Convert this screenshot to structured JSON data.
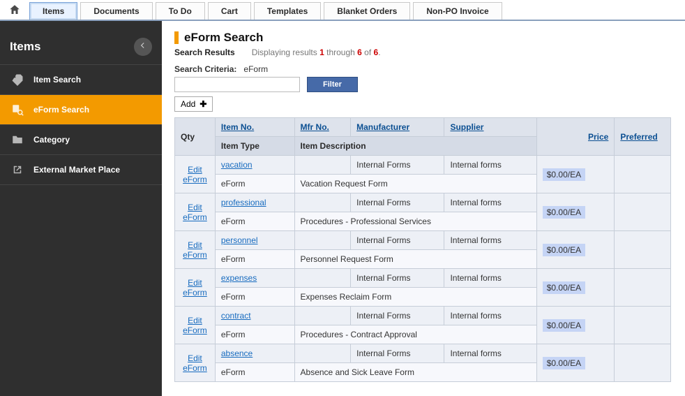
{
  "topnav": {
    "tabs": [
      "Items",
      "Documents",
      "To Do",
      "Cart",
      "Templates",
      "Blanket Orders",
      "Non-PO Invoice"
    ],
    "active_index": 0
  },
  "sidebar": {
    "title": "Items",
    "items": [
      {
        "label": "Item Search",
        "icon": "search-tag"
      },
      {
        "label": "eForm Search",
        "icon": "eform-search",
        "active": true
      },
      {
        "label": "Category",
        "icon": "folder"
      },
      {
        "label": "External Market Place",
        "icon": "external"
      }
    ]
  },
  "page": {
    "title": "eForm Search",
    "results_label": "Search Results",
    "display_prefix": "Displaying results ",
    "display_from": "1",
    "display_mid": " through ",
    "display_to": "6",
    "display_of": " of ",
    "display_total": "6",
    "display_suffix": ".",
    "criteria_label": "Search Criteria:",
    "criteria_value": "eForm",
    "filter_label": "Filter",
    "add_label": "Add"
  },
  "table": {
    "headers": {
      "qty": "Qty",
      "item_no": "Item No.",
      "mfr_no": "Mfr No.",
      "manufacturer": "Manufacturer",
      "supplier": "Supplier",
      "price": "Price",
      "preferred": "Preferred",
      "item_type": "Item Type",
      "item_description": "Item Description"
    },
    "edit_label": "Edit eForm",
    "rows": [
      {
        "item_no": "vacation",
        "mfr_no": "",
        "manufacturer": "Internal Forms",
        "supplier": "Internal forms",
        "price": "$0.00/EA",
        "item_type": "eForm",
        "description": "Vacation Request Form",
        "preferred": ""
      },
      {
        "item_no": "professional",
        "mfr_no": "",
        "manufacturer": "Internal Forms",
        "supplier": "Internal forms",
        "price": "$0.00/EA",
        "item_type": "eForm",
        "description": "Procedures - Professional Services",
        "preferred": ""
      },
      {
        "item_no": "personnel",
        "mfr_no": "",
        "manufacturer": "Internal Forms",
        "supplier": "Internal forms",
        "price": "$0.00/EA",
        "item_type": "eForm",
        "description": "Personnel Request Form",
        "preferred": ""
      },
      {
        "item_no": "expenses",
        "mfr_no": "",
        "manufacturer": "Internal Forms",
        "supplier": "Internal forms",
        "price": "$0.00/EA",
        "item_type": "eForm",
        "description": "Expenses Reclaim Form",
        "preferred": ""
      },
      {
        "item_no": "contract",
        "mfr_no": "",
        "manufacturer": "Internal Forms",
        "supplier": "Internal forms",
        "price": "$0.00/EA",
        "item_type": "eForm",
        "description": "Procedures - Contract Approval",
        "preferred": ""
      },
      {
        "item_no": "absence",
        "mfr_no": "",
        "manufacturer": "Internal Forms",
        "supplier": "Internal forms",
        "price": "$0.00/EA",
        "item_type": "eForm",
        "description": "Absence and Sick Leave Form",
        "preferred": ""
      }
    ]
  }
}
